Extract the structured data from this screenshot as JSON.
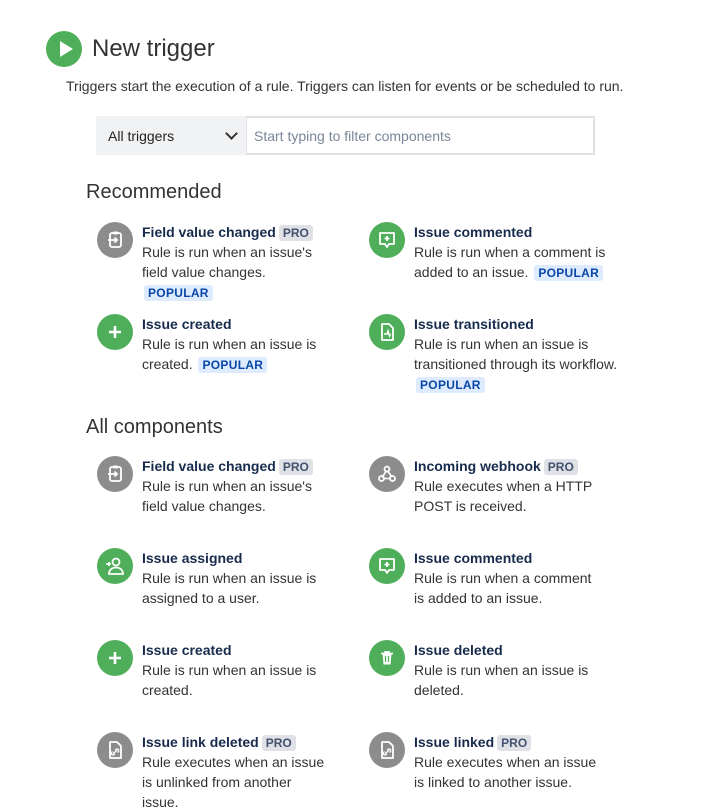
{
  "header": {
    "title": "New trigger",
    "description": "Triggers start the execution of a rule. Triggers can listen for events or be scheduled to run."
  },
  "filter": {
    "select_value": "All triggers",
    "placeholder": "Start typing to filter components"
  },
  "badges": {
    "pro": "PRO",
    "popular": "POPULAR"
  },
  "recommended": {
    "title": "Recommended",
    "items": [
      {
        "name": "Field value changed",
        "desc": "Rule is run when an issue's field value changes.",
        "icon": "field-change-icon"
      },
      {
        "name": "Issue commented",
        "desc": "Rule is run when a comment is added to an issue.",
        "icon": "comment-icon"
      },
      {
        "name": "Issue created",
        "desc": "Rule is run when an issue is created.",
        "icon": "plus-icon"
      },
      {
        "name": "Issue transitioned",
        "desc": "Rule is run when an issue is transitioned through its workflow.",
        "icon": "transition-icon"
      }
    ]
  },
  "all": {
    "title": "All components",
    "items": [
      {
        "name": "Field value changed",
        "desc": "Rule is run when an issue's field value changes.",
        "icon": "field-change-icon"
      },
      {
        "name": "Incoming webhook",
        "desc": "Rule executes when a HTTP POST is received.",
        "icon": "webhook-icon"
      },
      {
        "name": "Issue assigned",
        "desc": "Rule is run when an issue is assigned to a user.",
        "icon": "user-icon"
      },
      {
        "name": "Issue commented",
        "desc": "Rule is run when a comment is added to an issue.",
        "icon": "comment-icon"
      },
      {
        "name": "Issue created",
        "desc": "Rule is run when an issue is created.",
        "icon": "plus-icon"
      },
      {
        "name": "Issue deleted",
        "desc": "Rule is run when an issue is deleted.",
        "icon": "trash-icon"
      },
      {
        "name": "Issue link deleted",
        "desc": "Rule executes when an issue is unlinked from another issue.",
        "icon": "link-icon"
      },
      {
        "name": "Issue linked",
        "desc": "Rule executes when an issue is linked to another issue.",
        "icon": "link-icon"
      }
    ]
  },
  "colors": {
    "green": "#4fae5a",
    "grey": "#8c8c8c",
    "popular_bg": "#deebff",
    "popular_fg": "#0747a6"
  }
}
